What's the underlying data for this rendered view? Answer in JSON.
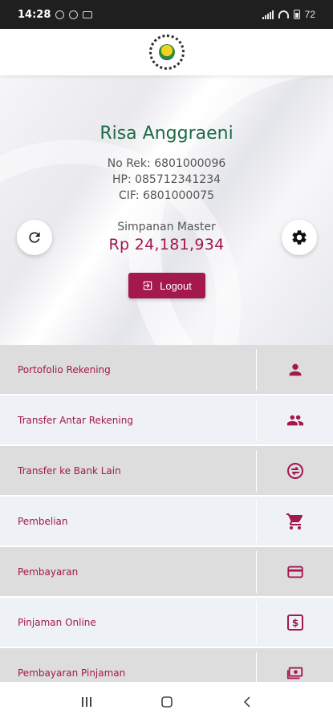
{
  "status_bar": {
    "time": "14:28",
    "battery": "72"
  },
  "profile": {
    "name": "Risa Anggraeni",
    "account_number": "No Rek: 6801000096",
    "phone": "HP: 085712341234",
    "cif": "CIF: 6801000075",
    "saving_label": "Simpanan Master",
    "saving_amount": "Rp 24,181,934"
  },
  "actions": {
    "logout_label": "Logout",
    "refresh_icon": "refresh-icon",
    "settings_icon": "gear-icon"
  },
  "menu": [
    {
      "label": "Portofolio Rekening",
      "icon": "person-icon"
    },
    {
      "label": "Transfer Antar Rekening",
      "icon": "people-icon"
    },
    {
      "label": "Transfer ke Bank Lain",
      "icon": "exchange-icon"
    },
    {
      "label": "Pembelian",
      "icon": "cart-icon"
    },
    {
      "label": "Pembayaran",
      "icon": "credit-card-icon"
    },
    {
      "label": "Pinjaman Online",
      "icon": "dollar-bill-icon"
    },
    {
      "label": "Pembayaran Pinjaman",
      "icon": "money-icon"
    }
  ],
  "colors": {
    "accent": "#a3184d",
    "name_green": "#1d6b44",
    "row_dark": "#dddddd",
    "row_light": "#eef1f5"
  }
}
